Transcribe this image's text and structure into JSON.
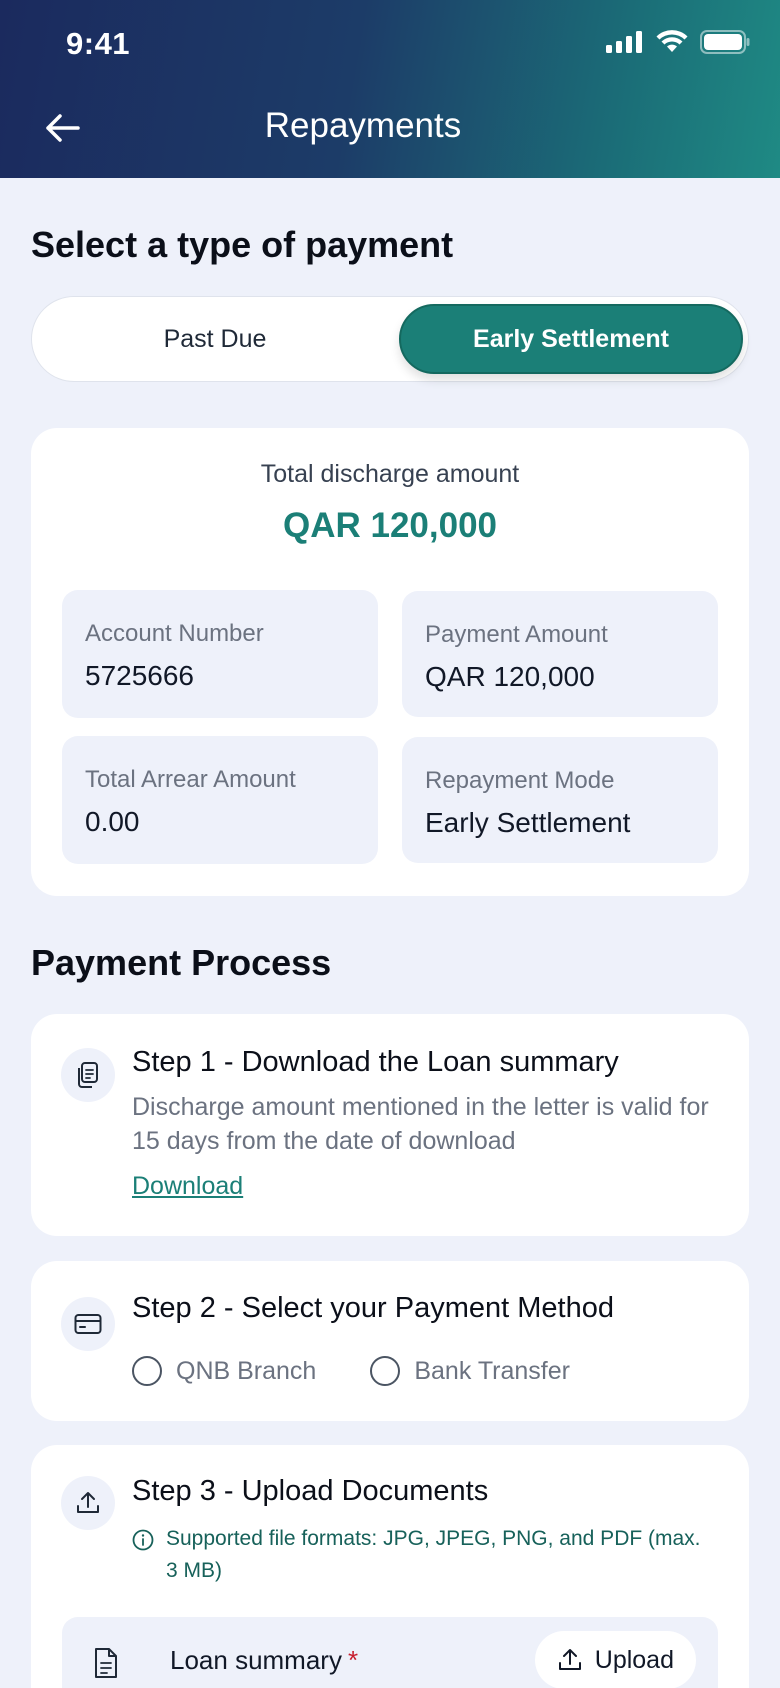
{
  "status_bar": {
    "time": "9:41"
  },
  "header": {
    "title": "Repayments"
  },
  "payment_type": {
    "heading": "Select a type of payment",
    "options": [
      "Past Due",
      "Early Settlement"
    ],
    "selected": "Early Settlement"
  },
  "summary": {
    "label": "Total discharge amount",
    "amount": "QAR 120,000",
    "tiles": [
      {
        "label": "Account Number",
        "value": "5725666"
      },
      {
        "label": "Payment Amount",
        "value": "QAR 120,000"
      },
      {
        "label": "Total Arrear Amount",
        "value": "0.00"
      },
      {
        "label": "Repayment Mode",
        "value": "Early Settlement"
      }
    ]
  },
  "process": {
    "heading": "Payment Process",
    "step1": {
      "title": "Step 1 - Download the Loan summary",
      "description": "Discharge amount mentioned in the letter is valid for 15 days from the date of download",
      "link": "Download",
      "icon": "document-copy-icon"
    },
    "step2": {
      "title": "Step 2 - Select your Payment Method",
      "options": [
        "QNB Branch",
        "Bank Transfer"
      ],
      "icon": "card-icon"
    },
    "step3": {
      "title": "Step 3 - Upload Documents",
      "note": "Supported file formats: JPG, JPEG, PNG, and PDF (max. 3 MB)",
      "icon": "upload-icon",
      "document_label": "Loan summary",
      "required_mark": "*",
      "upload_label": "Upload"
    }
  },
  "colors": {
    "accent": "#1b7f77",
    "header_start": "#1b2a5e",
    "header_end": "#1f8a84",
    "background": "#eef1fa",
    "required": "#c81e2e"
  }
}
